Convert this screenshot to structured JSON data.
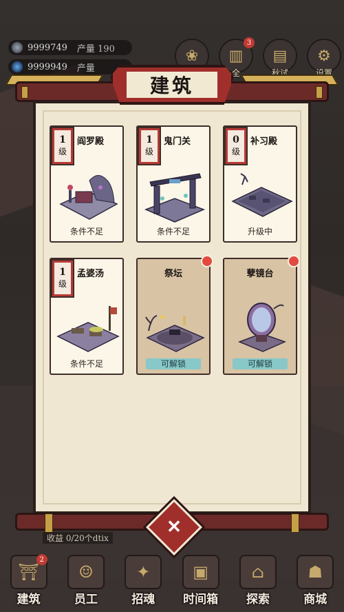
{
  "resources": [
    {
      "amount": "9999749",
      "prod_label": "产量 190"
    },
    {
      "amount": "9999949",
      "prod_label": "产量"
    }
  ],
  "top_icons": [
    {
      "name": "lotus-icon",
      "label": ""
    },
    {
      "name": "book-icon",
      "label": "全",
      "badge": "3"
    },
    {
      "name": "scroll-icon",
      "label": "秋试"
    },
    {
      "name": "gear-icon",
      "label": "设置"
    }
  ],
  "panel": {
    "title": "建筑",
    "buildings": [
      {
        "name": "阎罗殿",
        "level_num": "1",
        "level_unit": "级",
        "status": "条件不足",
        "locked": false
      },
      {
        "name": "鬼门关",
        "level_num": "1",
        "level_unit": "级",
        "status": "条件不足",
        "locked": false
      },
      {
        "name": "补习殿",
        "level_num": "0",
        "level_unit": "级",
        "status": "升级中",
        "locked": false
      },
      {
        "name": "孟婆汤",
        "level_num": "1",
        "level_unit": "级",
        "status": "条件不足",
        "locked": false
      },
      {
        "name": "祭坛",
        "status": "可解锁",
        "locked": true
      },
      {
        "name": "孽镜台",
        "status": "可解锁",
        "locked": true
      }
    ]
  },
  "info_line": "收益 0/20个dtix",
  "nav": [
    {
      "label": "建筑",
      "badge": "2"
    },
    {
      "label": "员工"
    },
    {
      "label": "招魂"
    },
    {
      "label": "时间箱"
    },
    {
      "label": "探索"
    },
    {
      "label": "商城"
    }
  ],
  "colors": {
    "accent_red": "#a02f2b",
    "paper": "#f0e7d2",
    "unlock_teal": "#88c8c9",
    "gold": "#c6a047"
  }
}
